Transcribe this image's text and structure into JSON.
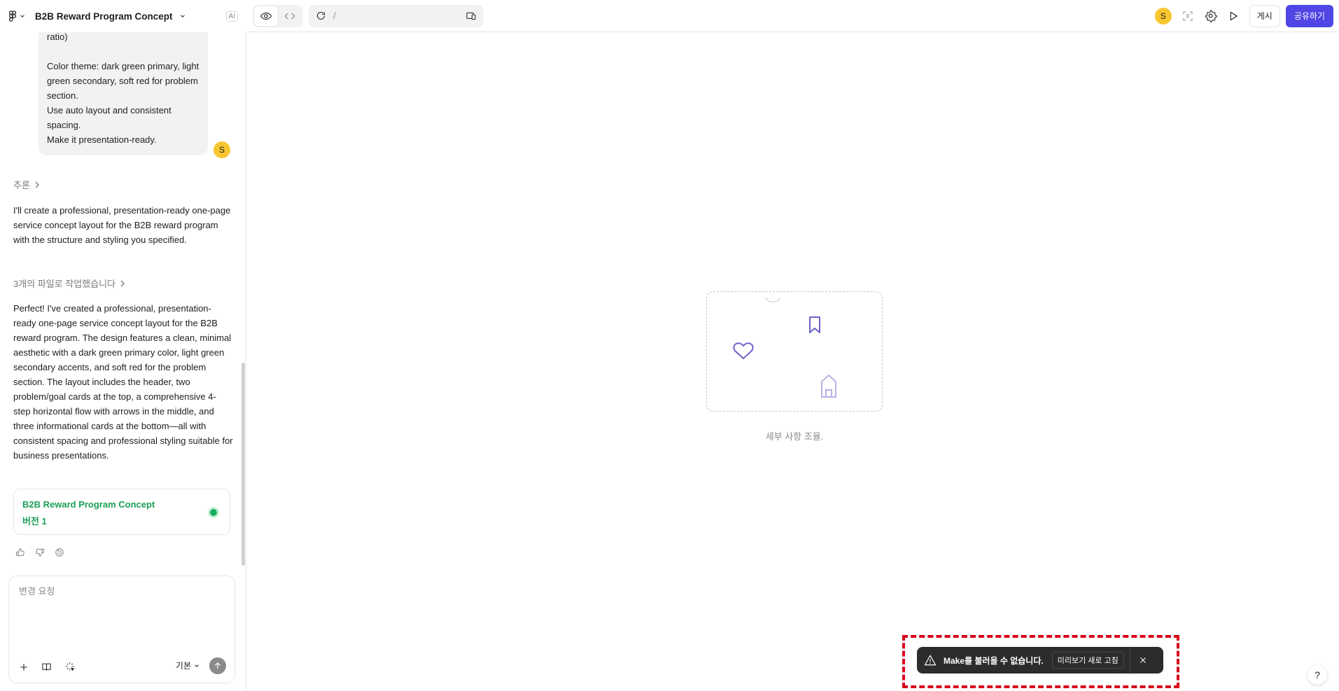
{
  "header": {
    "file_title": "B2B Reward Program Concept",
    "ai_badge": "AI",
    "url_path": "/",
    "user_initial": "S",
    "publish_label": "게시",
    "share_label": "공유하기"
  },
  "chat": {
    "user_message": {
      "lines_top": "ratio)",
      "paragraph_1": "Color theme: dark green primary, light green secondary, soft red for problem section.",
      "paragraph_2": "Use auto layout and consistent spacing.",
      "paragraph_3": "Make it presentation-ready.",
      "avatar_initial": "S"
    },
    "reasoning_label": "추론",
    "assistant_intro": "I'll create a professional, presentation-ready one-page service concept layout for the B2B reward program with the structure and styling you specified.",
    "files_label": "3개의 파일로 작업했습니다",
    "assistant_summary": "Perfect! I've created a professional, presentation-ready one-page service concept layout for the B2B reward program. The design features a clean, minimal aesthetic with a dark green primary color, light green secondary accents, and soft red for the problem section. The layout includes the header, two problem/goal cards at the top, a comprehensive 4-step horizontal flow with arrows in the middle, and three informational cards at the bottom—all with consistent spacing and professional styling suitable for business presentations.",
    "version_card": {
      "title": "B2B Reward Program Concept",
      "version": "버전 1"
    }
  },
  "composer": {
    "placeholder": "변경 요청",
    "model_label": "기본"
  },
  "preview": {
    "empty_caption": "세부 사항 조율."
  },
  "toast": {
    "message": "Make를 불러올 수 없습니다.",
    "refresh_label": "미리보기 새로 고침"
  },
  "help_label": "?",
  "colors": {
    "accent": "#4f46e5",
    "success": "#14ae5c",
    "avatar": "#f8c630",
    "toast_bg": "#2c2c2c",
    "highlight": "#d9001b"
  }
}
